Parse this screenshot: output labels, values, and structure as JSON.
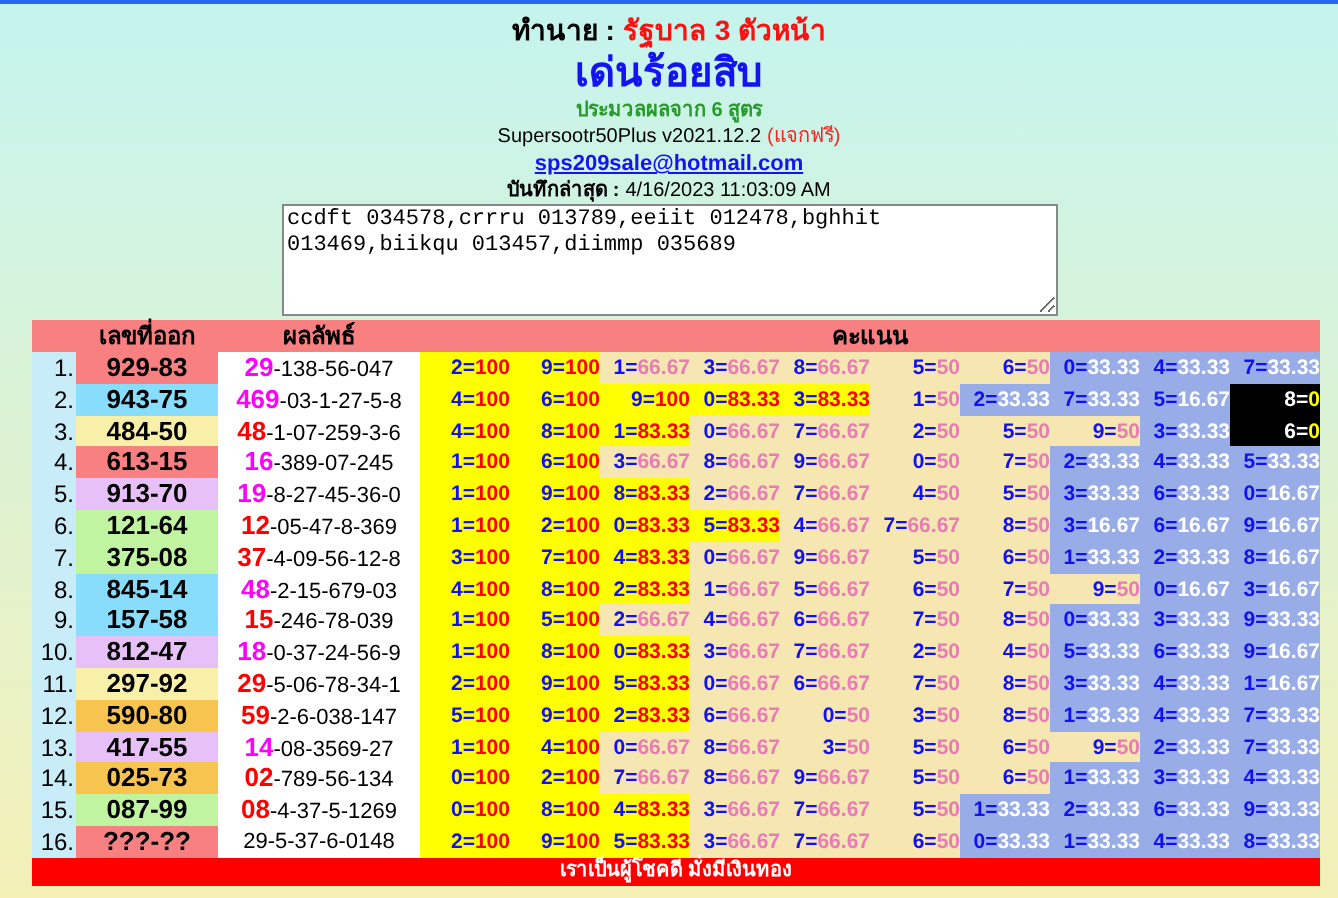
{
  "header": {
    "predict_label": "ทำนาย :",
    "predict_value": "รัฐบาล 3 ตัวหน้า",
    "title": "เด่นร้อยสิบ",
    "subtitle": "ประมวลผลจาก **6** สูตร",
    "version": "Supersootr50Plus v2021.12.2",
    "free_tag": "(แจกฟรี)",
    "email": "sps209sale@hotmail.com",
    "saved_label": "บันทึกล่าสุด :",
    "saved_value": "4/16/2023 11:03:09 AM"
  },
  "formulas_text": "ccdft 034578,crrru 013789,eeiit 012478,bghhit 013469,biikqu 013457,diimmp 035689",
  "table": {
    "columns": [
      "เลขที่ออก",
      "ผลลัพธ์",
      "คะแนน"
    ],
    "rows": [
      {
        "no": "1.",
        "result": "929-83",
        "color": "#f88080",
        "prefix": {
          "text": "29",
          "color": "#ff00ff"
        },
        "rest": "-138-56-047",
        "scores": [
          {
            "text": "2=100",
            "kind": "top"
          },
          {
            "text": "9=100",
            "kind": "top"
          },
          {
            "text": "1=66.67",
            "kind": "mid"
          },
          {
            "text": "3=66.67",
            "kind": "mid"
          },
          {
            "text": "8=66.67",
            "kind": "mid"
          },
          {
            "text": "5=50",
            "kind": "mid"
          },
          {
            "text": "6=50",
            "kind": "mid"
          },
          {
            "text": "0=33.33",
            "kind": "low"
          },
          {
            "text": "4=33.33",
            "kind": "low"
          },
          {
            "text": "7=33.33",
            "kind": "low"
          }
        ]
      },
      {
        "no": "2.",
        "result": "943-75",
        "color": "#88dcfc",
        "prefix": {
          "text": "469",
          "color": "#ff00ff"
        },
        "rest": "-03-1-27-5-8",
        "scores": [
          {
            "text": "4=100",
            "kind": "top"
          },
          {
            "text": "6=100",
            "kind": "top"
          },
          {
            "text": "9=100",
            "kind": "top"
          },
          {
            "text": "0=83.33",
            "kind": "top"
          },
          {
            "text": "3=83.33",
            "kind": "top"
          },
          {
            "text": "1=50",
            "kind": "mid"
          },
          {
            "text": "2=33.33",
            "kind": "low"
          },
          {
            "text": "7=33.33",
            "kind": "low"
          },
          {
            "text": "5=16.67",
            "kind": "low"
          },
          {
            "text": "8=0",
            "kind": "zero"
          }
        ]
      },
      {
        "no": "3.",
        "result": "484-50",
        "color": "#f8f0a8",
        "prefix": {
          "text": "48",
          "color": "#ff0000"
        },
        "rest": "-1-07-259-3-6",
        "scores": [
          {
            "text": "4=100",
            "kind": "top"
          },
          {
            "text": "8=100",
            "kind": "top"
          },
          {
            "text": "1=83.33",
            "kind": "top"
          },
          {
            "text": "0=66.67",
            "kind": "mid"
          },
          {
            "text": "7=66.67",
            "kind": "mid"
          },
          {
            "text": "2=50",
            "kind": "mid"
          },
          {
            "text": "5=50",
            "kind": "mid"
          },
          {
            "text": "9=50",
            "kind": "mid"
          },
          {
            "text": "3=33.33",
            "kind": "low"
          },
          {
            "text": "6=0",
            "kind": "zero"
          }
        ]
      },
      {
        "no": "4.",
        "result": "613-15",
        "color": "#f88080",
        "prefix": {
          "text": "16",
          "color": "#ff00ff"
        },
        "rest": "-389-07-245",
        "scores": [
          {
            "text": "1=100",
            "kind": "top"
          },
          {
            "text": "6=100",
            "kind": "top"
          },
          {
            "text": "3=66.67",
            "kind": "mid"
          },
          {
            "text": "8=66.67",
            "kind": "mid"
          },
          {
            "text": "9=66.67",
            "kind": "mid"
          },
          {
            "text": "0=50",
            "kind": "mid"
          },
          {
            "text": "7=50",
            "kind": "mid"
          },
          {
            "text": "2=33.33",
            "kind": "low"
          },
          {
            "text": "4=33.33",
            "kind": "low"
          },
          {
            "text": "5=33.33",
            "kind": "low"
          }
        ]
      },
      {
        "no": "5.",
        "result": "913-70",
        "color": "#e8c0f8",
        "prefix": {
          "text": "19",
          "color": "#ff00ff"
        },
        "rest": "-8-27-45-36-0",
        "scores": [
          {
            "text": "1=100",
            "kind": "top"
          },
          {
            "text": "9=100",
            "kind": "top"
          },
          {
            "text": "8=83.33",
            "kind": "top"
          },
          {
            "text": "2=66.67",
            "kind": "mid"
          },
          {
            "text": "7=66.67",
            "kind": "mid"
          },
          {
            "text": "4=50",
            "kind": "mid"
          },
          {
            "text": "5=50",
            "kind": "mid"
          },
          {
            "text": "3=33.33",
            "kind": "low"
          },
          {
            "text": "6=33.33",
            "kind": "low"
          },
          {
            "text": "0=16.67",
            "kind": "low"
          }
        ]
      },
      {
        "no": "6.",
        "result": "121-64",
        "color": "#c0f4a0",
        "prefix": {
          "text": "12",
          "color": "#ff0000"
        },
        "rest": "-05-47-8-369",
        "scores": [
          {
            "text": "1=100",
            "kind": "top"
          },
          {
            "text": "2=100",
            "kind": "top"
          },
          {
            "text": "0=83.33",
            "kind": "top"
          },
          {
            "text": "5=83.33",
            "kind": "top"
          },
          {
            "text": "4=66.67",
            "kind": "mid"
          },
          {
            "text": "7=66.67",
            "kind": "mid"
          },
          {
            "text": "8=50",
            "kind": "mid"
          },
          {
            "text": "3=16.67",
            "kind": "low"
          },
          {
            "text": "6=16.67",
            "kind": "low"
          },
          {
            "text": "9=16.67",
            "kind": "low"
          }
        ]
      },
      {
        "no": "7.",
        "result": "375-08",
        "color": "#c0f4a0",
        "prefix": {
          "text": "37",
          "color": "#ff0000"
        },
        "rest": "-4-09-56-12-8",
        "scores": [
          {
            "text": "3=100",
            "kind": "top"
          },
          {
            "text": "7=100",
            "kind": "top"
          },
          {
            "text": "4=83.33",
            "kind": "top"
          },
          {
            "text": "0=66.67",
            "kind": "mid"
          },
          {
            "text": "9=66.67",
            "kind": "mid"
          },
          {
            "text": "5=50",
            "kind": "mid"
          },
          {
            "text": "6=50",
            "kind": "mid"
          },
          {
            "text": "1=33.33",
            "kind": "low"
          },
          {
            "text": "2=33.33",
            "kind": "low"
          },
          {
            "text": "8=16.67",
            "kind": "low"
          }
        ]
      },
      {
        "no": "8.",
        "result": "845-14",
        "color": "#88dcfc",
        "prefix": {
          "text": "48",
          "color": "#ff00ff"
        },
        "rest": "-2-15-679-03",
        "scores": [
          {
            "text": "4=100",
            "kind": "top"
          },
          {
            "text": "8=100",
            "kind": "top"
          },
          {
            "text": "2=83.33",
            "kind": "top"
          },
          {
            "text": "1=66.67",
            "kind": "mid"
          },
          {
            "text": "5=66.67",
            "kind": "mid"
          },
          {
            "text": "6=50",
            "kind": "mid"
          },
          {
            "text": "7=50",
            "kind": "mid"
          },
          {
            "text": "9=50",
            "kind": "mid"
          },
          {
            "text": "0=16.67",
            "kind": "low"
          },
          {
            "text": "3=16.67",
            "kind": "low"
          }
        ]
      },
      {
        "no": "9.",
        "result": "157-58",
        "color": "#88dcfc",
        "prefix": {
          "text": "15",
          "color": "#ff0000"
        },
        "rest": "-246-78-039",
        "scores": [
          {
            "text": "1=100",
            "kind": "top"
          },
          {
            "text": "5=100",
            "kind": "top"
          },
          {
            "text": "2=66.67",
            "kind": "mid"
          },
          {
            "text": "4=66.67",
            "kind": "mid"
          },
          {
            "text": "6=66.67",
            "kind": "mid"
          },
          {
            "text": "7=50",
            "kind": "mid"
          },
          {
            "text": "8=50",
            "kind": "mid"
          },
          {
            "text": "0=33.33",
            "kind": "low"
          },
          {
            "text": "3=33.33",
            "kind": "low"
          },
          {
            "text": "9=33.33",
            "kind": "low"
          }
        ]
      },
      {
        "no": "10.",
        "result": "812-47",
        "color": "#e8c0f8",
        "prefix": {
          "text": "18",
          "color": "#ff00ff"
        },
        "rest": "-0-37-24-56-9",
        "scores": [
          {
            "text": "1=100",
            "kind": "top"
          },
          {
            "text": "8=100",
            "kind": "top"
          },
          {
            "text": "0=83.33",
            "kind": "top"
          },
          {
            "text": "3=66.67",
            "kind": "mid"
          },
          {
            "text": "7=66.67",
            "kind": "mid"
          },
          {
            "text": "2=50",
            "kind": "mid"
          },
          {
            "text": "4=50",
            "kind": "mid"
          },
          {
            "text": "5=33.33",
            "kind": "low"
          },
          {
            "text": "6=33.33",
            "kind": "low"
          },
          {
            "text": "9=16.67",
            "kind": "low"
          }
        ]
      },
      {
        "no": "11.",
        "result": "297-92",
        "color": "#f8f0a8",
        "prefix": {
          "text": "29",
          "color": "#ff0000"
        },
        "rest": "-5-06-78-34-1",
        "scores": [
          {
            "text": "2=100",
            "kind": "top"
          },
          {
            "text": "9=100",
            "kind": "top"
          },
          {
            "text": "5=83.33",
            "kind": "top"
          },
          {
            "text": "0=66.67",
            "kind": "mid"
          },
          {
            "text": "6=66.67",
            "kind": "mid"
          },
          {
            "text": "7=50",
            "kind": "mid"
          },
          {
            "text": "8=50",
            "kind": "mid"
          },
          {
            "text": "3=33.33",
            "kind": "low"
          },
          {
            "text": "4=33.33",
            "kind": "low"
          },
          {
            "text": "1=16.67",
            "kind": "low"
          }
        ]
      },
      {
        "no": "12.",
        "result": "590-80",
        "color": "#f8c450",
        "prefix": {
          "text": "59",
          "color": "#ff0000"
        },
        "rest": "-2-6-038-147",
        "scores": [
          {
            "text": "5=100",
            "kind": "top"
          },
          {
            "text": "9=100",
            "kind": "top"
          },
          {
            "text": "2=83.33",
            "kind": "top"
          },
          {
            "text": "6=66.67",
            "kind": "mid"
          },
          {
            "text": "0=50",
            "kind": "mid"
          },
          {
            "text": "3=50",
            "kind": "mid"
          },
          {
            "text": "8=50",
            "kind": "mid"
          },
          {
            "text": "1=33.33",
            "kind": "low"
          },
          {
            "text": "4=33.33",
            "kind": "low"
          },
          {
            "text": "7=33.33",
            "kind": "low"
          }
        ]
      },
      {
        "no": "13.",
        "result": "417-55",
        "color": "#e8c0f8",
        "prefix": {
          "text": "14",
          "color": "#ff00ff"
        },
        "rest": "-08-3569-27",
        "scores": [
          {
            "text": "1=100",
            "kind": "top"
          },
          {
            "text": "4=100",
            "kind": "top"
          },
          {
            "text": "0=66.67",
            "kind": "mid"
          },
          {
            "text": "8=66.67",
            "kind": "mid"
          },
          {
            "text": "3=50",
            "kind": "mid"
          },
          {
            "text": "5=50",
            "kind": "mid"
          },
          {
            "text": "6=50",
            "kind": "mid"
          },
          {
            "text": "9=50",
            "kind": "mid"
          },
          {
            "text": "2=33.33",
            "kind": "low"
          },
          {
            "text": "7=33.33",
            "kind": "low"
          }
        ]
      },
      {
        "no": "14.",
        "result": "025-73",
        "color": "#f8c450",
        "prefix": {
          "text": "02",
          "color": "#ff0000"
        },
        "rest": "-789-56-134",
        "scores": [
          {
            "text": "0=100",
            "kind": "top"
          },
          {
            "text": "2=100",
            "kind": "top"
          },
          {
            "text": "7=66.67",
            "kind": "mid"
          },
          {
            "text": "8=66.67",
            "kind": "mid"
          },
          {
            "text": "9=66.67",
            "kind": "mid"
          },
          {
            "text": "5=50",
            "kind": "mid"
          },
          {
            "text": "6=50",
            "kind": "mid"
          },
          {
            "text": "1=33.33",
            "kind": "low"
          },
          {
            "text": "3=33.33",
            "kind": "low"
          },
          {
            "text": "4=33.33",
            "kind": "low"
          }
        ]
      },
      {
        "no": "15.",
        "result": "087-99",
        "color": "#c0f4a0",
        "prefix": {
          "text": "08",
          "color": "#ff0000"
        },
        "rest": "-4-37-5-1269",
        "scores": [
          {
            "text": "0=100",
            "kind": "top"
          },
          {
            "text": "8=100",
            "kind": "top"
          },
          {
            "text": "4=83.33",
            "kind": "top"
          },
          {
            "text": "3=66.67",
            "kind": "mid"
          },
          {
            "text": "7=66.67",
            "kind": "mid"
          },
          {
            "text": "5=50",
            "kind": "mid"
          },
          {
            "text": "1=33.33",
            "kind": "low"
          },
          {
            "text": "2=33.33",
            "kind": "low"
          },
          {
            "text": "6=33.33",
            "kind": "low"
          },
          {
            "text": "9=33.33",
            "kind": "low"
          }
        ]
      },
      {
        "no": "16.",
        "result": "???-??",
        "color": "#f88080",
        "rest": "29-5-37-6-0148",
        "scores": [
          {
            "text": "2=100",
            "kind": "top"
          },
          {
            "text": "9=100",
            "kind": "top"
          },
          {
            "text": "5=83.33",
            "kind": "top"
          },
          {
            "text": "3=66.67",
            "kind": "mid"
          },
          {
            "text": "7=66.67",
            "kind": "mid"
          },
          {
            "text": "6=50",
            "kind": "mid"
          },
          {
            "text": "0=33.33",
            "kind": "low"
          },
          {
            "text": "1=33.33",
            "kind": "low"
          },
          {
            "text": "4=33.33",
            "kind": "low"
          },
          {
            "text": "8=33.33",
            "kind": "low"
          }
        ]
      }
    ]
  },
  "footer": "เราเป็นผู้โชคดี มั่งมีเงินทอง"
}
